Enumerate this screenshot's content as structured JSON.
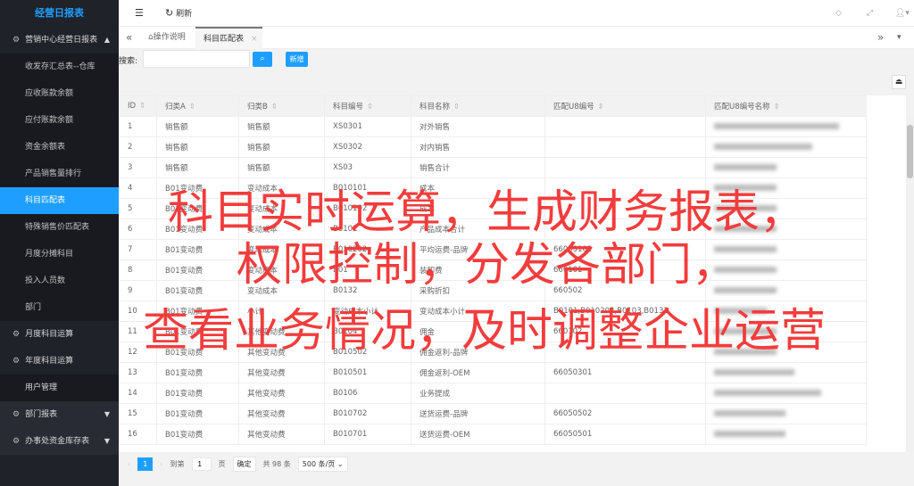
{
  "sidebar": {
    "logo": "经营日报表",
    "group1": {
      "label": "营销中心经营日报表",
      "items": [
        "收发存汇总表--仓库",
        "应收账款余额",
        "应付账款余额",
        "资金余额表",
        "产品销售量排行",
        "科目匹配表",
        "特殊销售价匹配表",
        "月度分摊科目",
        "投入人员数",
        "部门"
      ],
      "active": 5
    },
    "group2": "月度科目运算",
    "group3": "年度科目运算",
    "group4": "用户管理",
    "group5": "部门报表",
    "group6": "办事处资金库存表"
  },
  "header": {
    "refresh": "刷新"
  },
  "tabs": {
    "home": "操作说明",
    "current": "科目匹配表"
  },
  "search": {
    "label": "搜索:",
    "placeholder": "",
    "add": "新增"
  },
  "table": {
    "columns": [
      "ID",
      "归类A",
      "归类B",
      "科目编号",
      "科目名称",
      "匹配U8编号",
      "匹配U8编号名称"
    ],
    "rows": [
      [
        "1",
        "销售额",
        "销售额",
        "XS0301",
        "对外销售",
        ""
      ],
      [
        "2",
        "销售额",
        "销售额",
        "XS0302",
        "对内销售",
        ""
      ],
      [
        "3",
        "销售额",
        "销售额",
        "XS03",
        "销售合计",
        ""
      ],
      [
        "4",
        "B01变动费",
        "变动成本",
        "B010101",
        "成本",
        ""
      ],
      [
        "5",
        "B01变动费",
        "变动成本",
        "B010102",
        "成本",
        ""
      ],
      [
        "6",
        "B01变动费",
        "变动成本",
        "B0101",
        "产品成本合计",
        ""
      ],
      [
        "7",
        "B01变动费",
        "变动成本",
        "B010202",
        "平均运费-品牌",
        "66053102"
      ],
      [
        "8",
        "B01变动费",
        "变动成本",
        "B01",
        "装卸费",
        "660101"
      ],
      [
        "9",
        "B01变动费",
        "变动成本",
        "B0132",
        "采购折扣",
        "660502"
      ],
      [
        "10",
        "B01变动费",
        "小计",
        "变动成本小计",
        "变动成本小计",
        "B0101,B010202,B0103,B0132"
      ],
      [
        "11",
        "B01变动费",
        "其他变动费",
        "B0104",
        "佣金",
        "660102"
      ],
      [
        "12",
        "B01变动费",
        "其他变动费",
        "B010502",
        "佣金返利-品牌",
        ""
      ],
      [
        "13",
        "B01变动费",
        "其他变动费",
        "B010501",
        "佣金返利-OEM",
        "66050301"
      ],
      [
        "14",
        "B01变动费",
        "其他变动费",
        "B0106",
        "业务提成",
        ""
      ],
      [
        "15",
        "B01变动费",
        "其他变动费",
        "B010702",
        "送货运费-品牌",
        "66050502"
      ],
      [
        "16",
        "B01变动费",
        "其他变动费",
        "B010701",
        "送货运费-OEM",
        "66050501"
      ]
    ]
  },
  "pager": {
    "current": "1",
    "goto": "到第",
    "page_value": "1",
    "page_unit": "页",
    "confirm": "确定",
    "total": "共 98 条",
    "size": "500 条/页"
  },
  "overlay": [
    "科目实时运算，生成财务报表，",
    "权限控制，分发各部门，",
    "查看业务情况，及时调整企业运营"
  ],
  "colors": {
    "accent": "#1e9fff",
    "sidebar": "#20222a",
    "overlay": "#f23c3c"
  }
}
